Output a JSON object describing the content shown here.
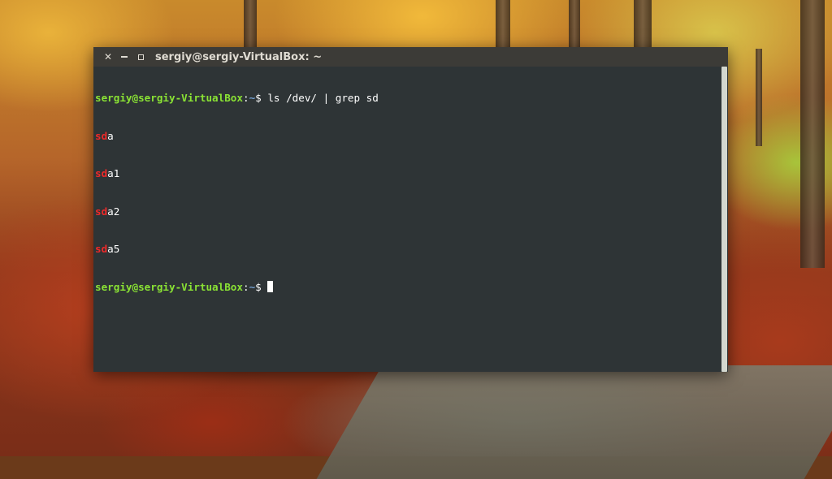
{
  "window": {
    "title": "sergiy@sergiy-VirtualBox: ~",
    "close_icon": "close-icon",
    "minimize_icon": "minimize-icon",
    "maximize_icon": "maximize-icon"
  },
  "terminal": {
    "prompt_user_host": "sergiy@sergiy-VirtualBox",
    "prompt_sep": ":",
    "prompt_path": "~",
    "prompt_symbol": "$ ",
    "command": "ls /dev/ | grep sd",
    "output": [
      {
        "match": "sd",
        "rest": "a"
      },
      {
        "match": "sd",
        "rest": "a1"
      },
      {
        "match": "sd",
        "rest": "a2"
      },
      {
        "match": "sd",
        "rest": "a5"
      }
    ]
  },
  "colors": {
    "terminal_bg": "#2e3436",
    "prompt_green": "#8ae234",
    "path_blue": "#729fcf",
    "match_red": "#ef2929",
    "titlebar_bg": "#3c3b37"
  }
}
